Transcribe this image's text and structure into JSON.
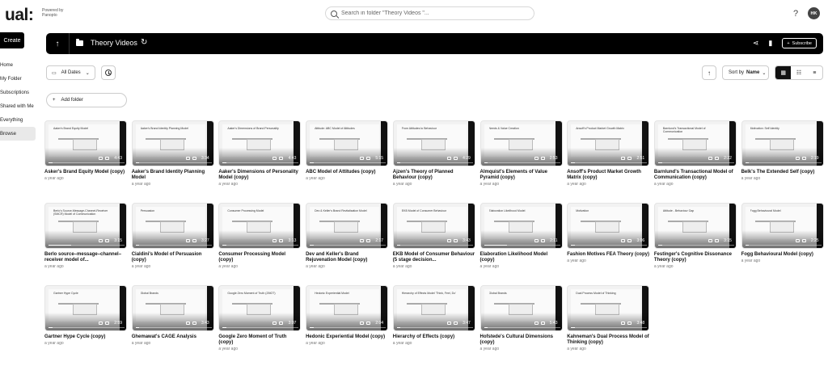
{
  "brand": {
    "logo": "ual:",
    "powered_line1": "Powered by",
    "powered_line2": "Panopto"
  },
  "search": {
    "placeholder": "Search in folder \"Theory Videos \"..."
  },
  "header": {
    "help": "?",
    "avatar_initials": "HK"
  },
  "sidebar": {
    "create_label": "Create",
    "items": [
      {
        "label": "Home"
      },
      {
        "label": "My Folder"
      },
      {
        "label": "Subscriptions"
      },
      {
        "label": "Shared with Me"
      },
      {
        "label": "Everything"
      },
      {
        "label": "Browse"
      }
    ]
  },
  "folder": {
    "title": "Theory Videos",
    "subscribe_label": "Subscribe"
  },
  "toolbar": {
    "date_filter": "All Dates",
    "sort_label": "Sort by",
    "sort_value": "Name",
    "add_folder_label": "Add folder"
  },
  "icons": {
    "back": "arrow-up-icon",
    "folder": "folder-icon",
    "refresh": "refresh-icon",
    "share": "share-icon",
    "stats": "stats-icon",
    "plus": "plus-icon",
    "calendar": "calendar-icon",
    "clock": "clock-icon",
    "grid": "grid-view-icon",
    "detail": "detail-view-icon",
    "list": "list-view-icon",
    "search": "search-icon"
  },
  "videos": [
    {
      "title": "Asker's Brand Equity Model (copy)",
      "date": "a year ago",
      "duration": "4:43",
      "thumb_text": "Aaker's Brand Equity Model",
      "progress": 0.05
    },
    {
      "title": "Aaker's Brand Identity Planning Model",
      "date": "a year ago",
      "duration": "3:34",
      "thumb_text": "Aaker's Brand Identity Planning Model",
      "progress": 0.05
    },
    {
      "title": "Aaker's Dimensions of Personality Model (copy)",
      "date": "a year ago",
      "duration": "4:43",
      "thumb_text": "Aaker's Dimensions of Brand Personality",
      "progress": 0.05
    },
    {
      "title": "ABC Model of Attitudes (copy)",
      "date": "a year ago",
      "duration": "5:15",
      "thumb_text": "Attitude: ABC Model of Attitudes",
      "progress": 0.05
    },
    {
      "title": "Ajzen's Theory of Planned Behaviour (copy)",
      "date": "a year ago",
      "duration": "4:29",
      "thumb_text": "From Attitudes to Behaviour",
      "progress": 0.05
    },
    {
      "title": "Almquist's Elements of Value Pyramid (copy)",
      "date": "a year ago",
      "duration": "2:53",
      "thumb_text": "Needs & Value Creation",
      "progress": 0.05
    },
    {
      "title": "Ansoff's Product Market Growth Matrix (copy)",
      "date": "a year ago",
      "duration": "2:51",
      "thumb_text": "Ansoff's Product Market Growth Matrix",
      "progress": 0.05
    },
    {
      "title": "Barnlund's Transactional Model of Communication (copy)",
      "date": "a year ago",
      "duration": "2:22",
      "thumb_text": "Barnlund's Transactional Model of Communication",
      "progress": 0.05
    },
    {
      "title": "Belk's The Extended Self (copy)",
      "date": "a year ago",
      "duration": "2:19",
      "thumb_text": "Motivation: Self Identity",
      "progress": 0.05
    },
    {
      "title": "Berlo source–message–channel–receiver model of...",
      "date": "a year ago",
      "duration": "3:15",
      "thumb_text": "Berlo's Source-Message-Channel-Receiver (SMCR) Model of Communication",
      "progress": 0.3
    },
    {
      "title": "Cialdini's Model of Persuasion (copy)",
      "date": "a year ago",
      "duration": "3:27",
      "thumb_text": "Persuasion",
      "progress": 0.05
    },
    {
      "title": "Consumer Processing Model (copy)",
      "date": "a year ago",
      "duration": "3:13",
      "thumb_text": "Consumer Processing Model",
      "progress": 0.05
    },
    {
      "title": "Dev and Keller's Brand Rejuvenation Model (copy)",
      "date": "a year ago",
      "duration": "2:17",
      "thumb_text": "Dev & Keller's Brand Revitalisation Model",
      "progress": 0.05
    },
    {
      "title": "EKB Model of Consumer Behaviour (5 stage decision...",
      "date": "a year ago",
      "duration": "3:43",
      "thumb_text": "EKB Model of Consumer Behaviour",
      "progress": 0.05
    },
    {
      "title": "Elaboration Likelihood Model (copy)",
      "date": "a year ago",
      "duration": "2:11",
      "thumb_text": "Elaboration Likelihood Model",
      "progress": 0.3
    },
    {
      "title": "Fashion Motives FEA Theory (copy)",
      "date": "a year ago",
      "duration": "3:06",
      "thumb_text": "Motivation",
      "progress": 0.05
    },
    {
      "title": "Festinger's Cognitive Dissonance Theory (copy)",
      "date": "a year ago",
      "duration": "3:15",
      "thumb_text": "Attitude - Behaviour Gap",
      "progress": 0.05
    },
    {
      "title": "Fogg Behavioural Model (copy)",
      "date": "a year ago",
      "duration": "2:25",
      "thumb_text": "Fogg Behavioural Model",
      "progress": 0.05
    },
    {
      "title": "Gartner Hype Cycle (copy)",
      "date": "a year ago",
      "duration": "2:59",
      "thumb_text": "Gartner Hype Cycle",
      "progress": 0.05
    },
    {
      "title": "Ghemawat's CAGE Analysis",
      "date": "a year ago",
      "duration": "3:43",
      "thumb_text": "Global Brands",
      "progress": 0.05
    },
    {
      "title": "Google Zero Moment of Truth (copy)",
      "date": "a year ago",
      "duration": "3:07",
      "thumb_text": "Google Zero Moment of Truth (ZMOT)",
      "progress": 0.05
    },
    {
      "title": "Hedonic Experiential Model (copy)",
      "date": "a year ago",
      "duration": "2:04",
      "thumb_text": "Hedonic Experiential Model",
      "progress": 0.05
    },
    {
      "title": "Hierarchy of Effects (copy)",
      "date": "a year ago",
      "duration": "3:47",
      "thumb_text": "Hierarchy of Effects Model 'Think, Feel, Do'",
      "progress": 0.05
    },
    {
      "title": "Hofstede's Cultural Dimensions (copy)",
      "date": "a year ago",
      "duration": "5:43",
      "thumb_text": "Global Brands",
      "progress": 0.05
    },
    {
      "title": "Kahneman's Dual Process Model of Thinking (copy)",
      "date": "a year ago",
      "duration": "3:48",
      "thumb_text": "Dual Process Model of Thinking",
      "progress": 0.05
    }
  ]
}
